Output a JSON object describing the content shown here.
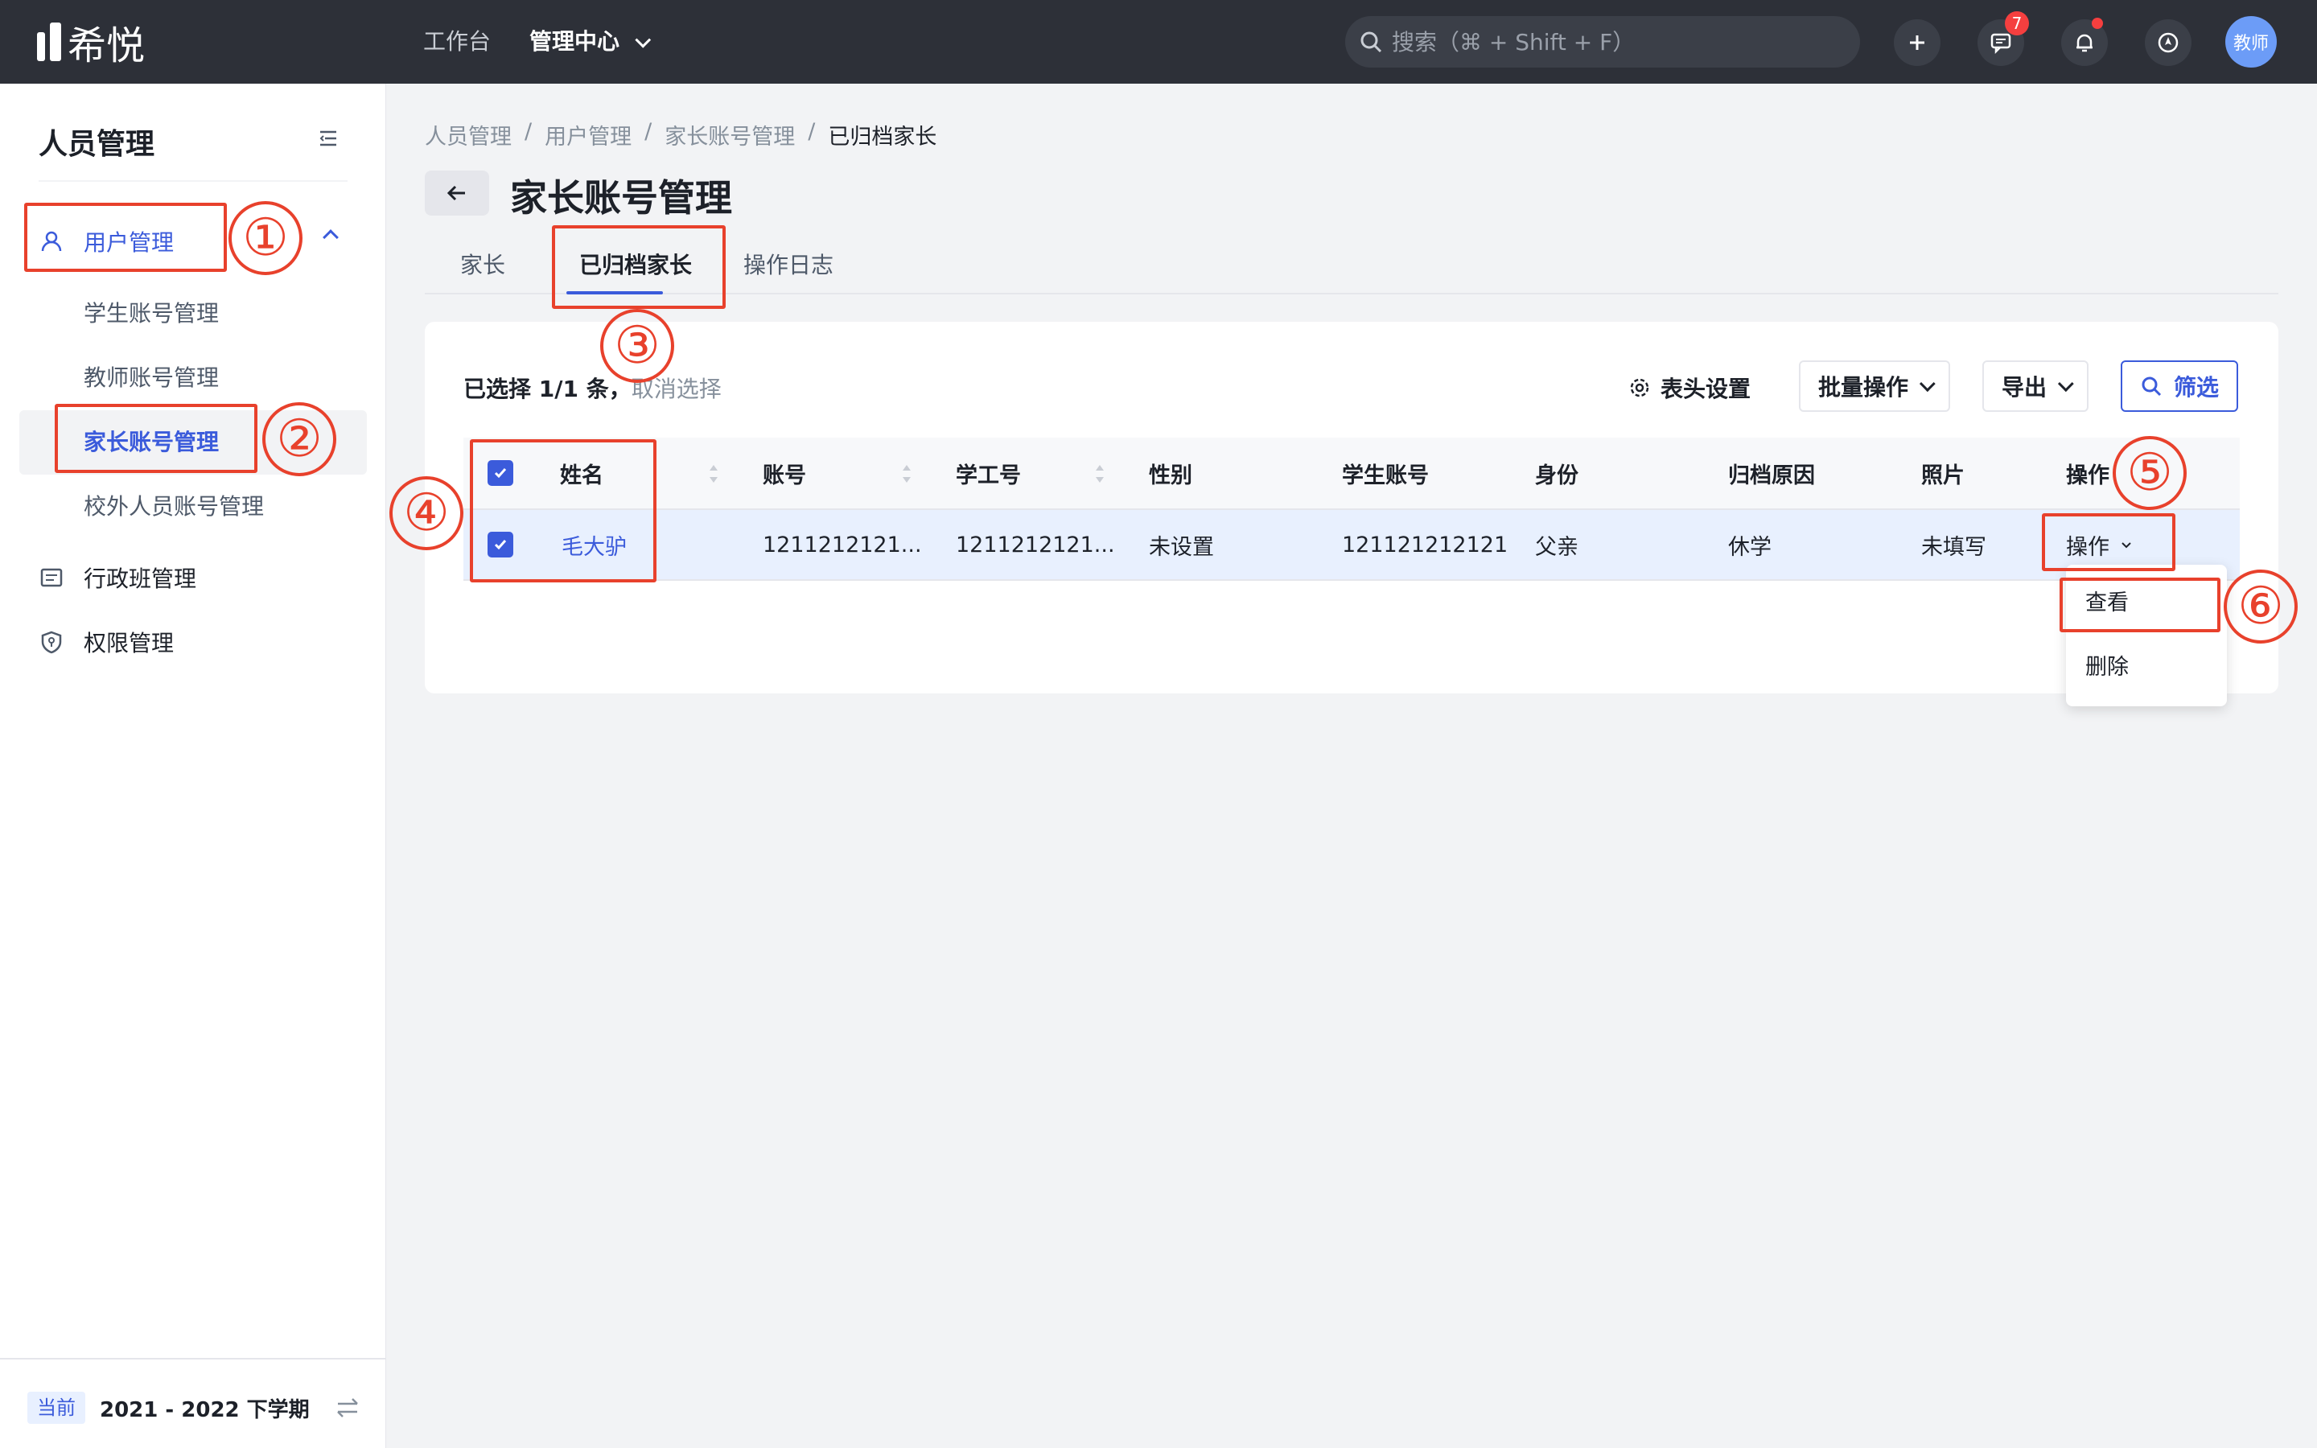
{
  "app": {
    "logo_text": "希悦"
  },
  "topnav": {
    "workbench": "工作台",
    "admin_center": "管理中心"
  },
  "search": {
    "placeholder": "搜索（⌘ + Shift + F）"
  },
  "header_icons": {
    "message_count": "7",
    "avatar_text": "教师"
  },
  "sidebar": {
    "title": "人员管理",
    "groups": {
      "user_mgmt": "用户管理",
      "class_mgmt": "行政班管理",
      "perm_mgmt": "权限管理"
    },
    "sub_items": {
      "student": "学生账号管理",
      "teacher": "教师账号管理",
      "parent": "家长账号管理",
      "external": "校外人员账号管理"
    },
    "footer": {
      "tag": "当前",
      "term": "2021 - 2022 下学期"
    }
  },
  "breadcrumb": [
    "人员管理",
    "用户管理",
    "家长账号管理",
    "已归档家长"
  ],
  "breadcrumb_sep": "/",
  "page_title": "家长账号管理",
  "tabs": {
    "parent": "家长",
    "archived": "已归档家长",
    "log": "操作日志"
  },
  "toolbar": {
    "selected_text": "已选择 1/1 条，",
    "cancel_select": "取消选择",
    "header_settings": "表头设置",
    "batch_ops": "批量操作",
    "export": "导出",
    "filter": "筛选"
  },
  "table": {
    "columns": [
      "姓名",
      "账号",
      "学工号",
      "性别",
      "学生账号",
      "身份",
      "归档原因",
      "照片",
      "操作"
    ],
    "row": {
      "name": "毛大驴",
      "account": "1211212121...",
      "staff_no": "1211212121...",
      "gender": "未设置",
      "student_account": "121121212121",
      "identity": "父亲",
      "archive_reason": "休学",
      "photo": "未填写",
      "action": "操作"
    }
  },
  "dropdown": {
    "view": "查看",
    "delete": "删除"
  },
  "annotations": [
    "①",
    "②",
    "③",
    "④",
    "⑤",
    "⑥"
  ],
  "colors": {
    "accent": "#3b5bdb",
    "annotation": "#e8412c",
    "topbar": "#2d3038"
  }
}
